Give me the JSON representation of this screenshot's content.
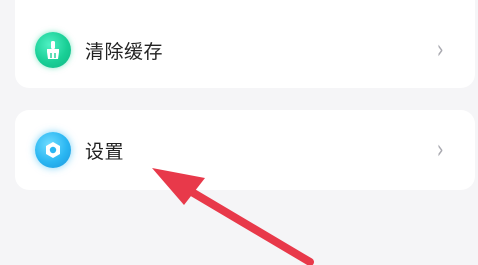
{
  "menu": {
    "items": [
      {
        "label": "清除缓存",
        "icon": "broom-icon",
        "chevron": "›"
      },
      {
        "label": "设置",
        "icon": "settings-gear-icon",
        "chevron": "›"
      }
    ]
  },
  "colors": {
    "clear_icon": "#19cf96",
    "settings_icon": "#2ab6f2",
    "annotation_arrow": "#e8394a"
  }
}
